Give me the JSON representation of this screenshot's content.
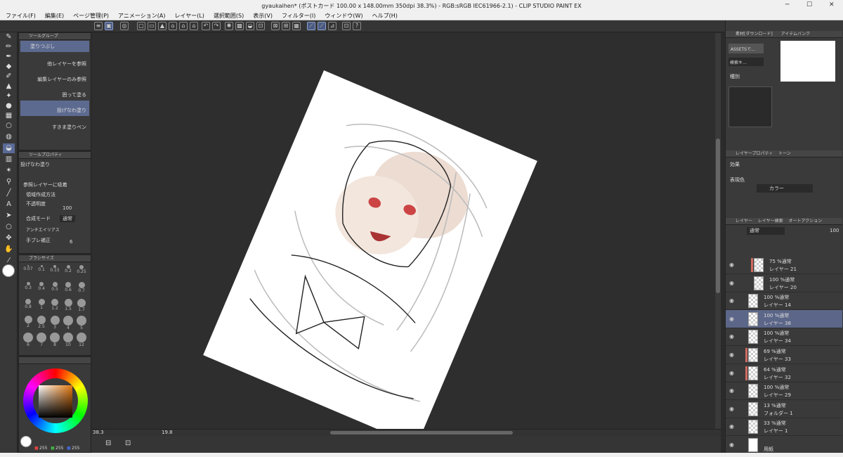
{
  "window": {
    "title": "gyaukaihen* (ポストカード 100.00 x 148.00mm 350dpi 38.3%) - RGB:sRGB IEC61966-2.1) - CLIP STUDIO PAINT EX",
    "minimize": "─",
    "maximize": "☐",
    "close": "✕"
  },
  "menu": [
    "ファイル(F)",
    "編集(E)",
    "ページ管理(P)",
    "アニメーション(A)",
    "レイヤー(L)",
    "選択範囲(S)",
    "表示(V)",
    "フィルター(I)",
    "ウィンドウ(W)",
    "ヘルプ(H)"
  ],
  "tool_group": {
    "header": "ツールグループ",
    "items": [
      {
        "label": "塗りつぶし",
        "selected": true
      },
      {
        "label": "他レイヤーを参照",
        "selected": false
      },
      {
        "label": "編集レイヤーのみ参照",
        "selected": false
      },
      {
        "label": "囲って塗る",
        "selected": false
      },
      {
        "label": "投げなわ塗り",
        "selected": true
      },
      {
        "label": "すきま塗りペン",
        "selected": false
      }
    ]
  },
  "tool_property": {
    "header": "ツールプロパティ",
    "tool_name": "投げなわ塗り",
    "ref_layer": "参照レイヤーに吸着",
    "region_method": "領域作成方法",
    "opacity_label": "不透明度",
    "opacity_value": "100",
    "blend_label": "合成モード",
    "blend_value": "通常",
    "aa_label": "アンチエイリアス",
    "stab_label": "手ブレ補正",
    "stab_value": "6"
  },
  "brush_size": {
    "header": "ブラシサイズ",
    "sizes": [
      "0.07",
      "0.1",
      "0.15",
      "0.2",
      "0.25",
      "0.3",
      "0.4",
      "0.5",
      "0.6",
      "0.7",
      "0.8",
      "1",
      "1.2",
      "1.5",
      "1.7",
      "2",
      "2.5",
      "3",
      "4",
      "5",
      "6",
      "7",
      "8",
      "10",
      "12"
    ]
  },
  "color": {
    "r": "255",
    "g": "255",
    "b": "255",
    "hue_color": "#e87a10"
  },
  "canvas": {
    "zoom": "38.3",
    "rotate": "19.8"
  },
  "right": {
    "material_tab": "素材[ダウンロード]",
    "material_tab2": "アイテムバンク",
    "assets_btn": "ASSETSで…",
    "search": "検索キ…",
    "kind": "種別",
    "layer_prop_tab": "レイヤープロパティ",
    "layer_prop_tab2": "トーン",
    "effect": "効果",
    "expression_color": "表現色",
    "color_mode": "カラー",
    "layer_tab": "レイヤー",
    "layer_tab2": "レイヤー検索",
    "layer_tab3": "オートアクション",
    "blend": "通常",
    "opacity": "100"
  },
  "layers": [
    {
      "mode": "75 %通常",
      "name": "レイヤー 21",
      "red": true,
      "selected": false,
      "indent": 1
    },
    {
      "mode": "100 %通常",
      "name": "レイヤー 20",
      "red": false,
      "selected": false,
      "indent": 1
    },
    {
      "mode": "100 %通常",
      "name": "レイヤー 14",
      "red": false,
      "selected": false,
      "indent": 0
    },
    {
      "mode": "100 %通常",
      "name": "レイヤー 38",
      "red": false,
      "selected": true,
      "indent": 0
    },
    {
      "mode": "100 %通常",
      "name": "レイヤー 34",
      "red": false,
      "selected": false,
      "indent": 0
    },
    {
      "mode": "69 %通常",
      "name": "レイヤー 33",
      "red": true,
      "selected": false,
      "indent": 0
    },
    {
      "mode": "64 %通常",
      "name": "レイヤー 32",
      "red": true,
      "selected": false,
      "indent": 0
    },
    {
      "mode": "100 %通常",
      "name": "レイヤー 29",
      "red": false,
      "selected": false,
      "indent": 0
    },
    {
      "mode": "13 %通常",
      "name": "フォルダー 1",
      "red": false,
      "selected": false,
      "indent": 0,
      "folder": true
    },
    {
      "mode": "33 %通常",
      "name": "レイヤー 1",
      "red": false,
      "selected": false,
      "indent": 0
    },
    {
      "mode": "",
      "name": "用紙",
      "red": false,
      "selected": false,
      "indent": 0,
      "paper": true
    }
  ]
}
